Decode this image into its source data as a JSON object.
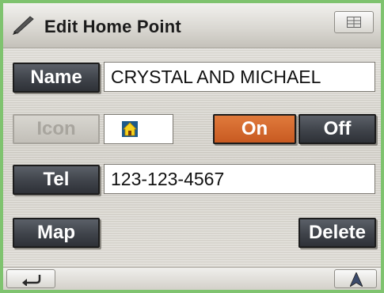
{
  "header": {
    "title": "Edit Home Point",
    "title_icon": "pencil-icon",
    "menu_icon": "grid-menu-icon"
  },
  "name": {
    "button_label": "Name",
    "value": "CRYSTAL AND MICHAEL"
  },
  "icon": {
    "button_label": "Icon",
    "selected_icon": "home-icon",
    "on_label": "On",
    "off_label": "Off",
    "active": "On"
  },
  "tel": {
    "button_label": "Tel",
    "value": "123-123-4567"
  },
  "actions": {
    "map_label": "Map",
    "delete_label": "Delete"
  },
  "footer": {
    "back_icon": "return-arrow-icon",
    "nav_icon": "navigation-arrow-icon"
  },
  "colors": {
    "frame": "#7fc36f",
    "on_active": "#d4692e",
    "dark_button": "#3f434a"
  }
}
